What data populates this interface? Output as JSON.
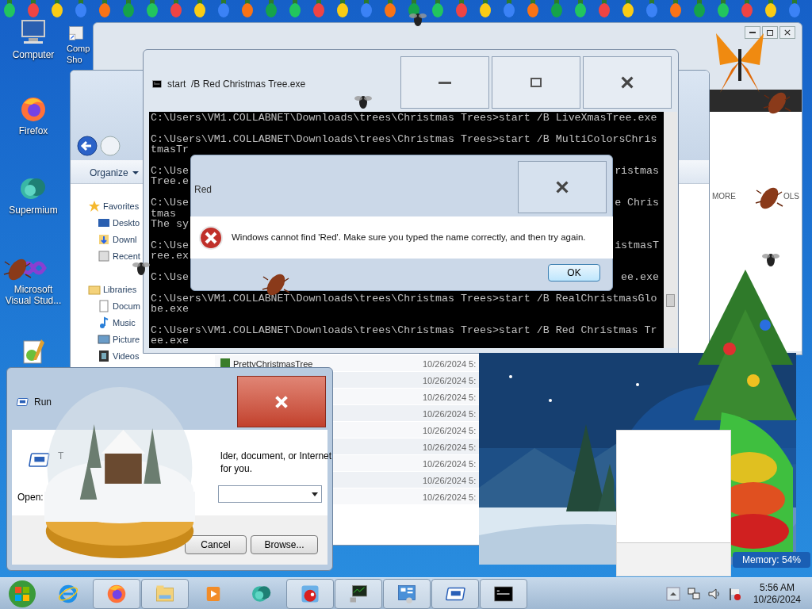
{
  "desktop_icons": [
    {
      "kind": "computer",
      "label": "Computer"
    },
    {
      "kind": "shortcut",
      "label": "Comp Sho"
    },
    {
      "kind": "firefox",
      "label": "Firefox"
    },
    {
      "kind": "supermium",
      "label": "Supermium"
    },
    {
      "kind": "vs",
      "label": "Microsoft Visual Stud..."
    },
    {
      "kind": "notepad"
    }
  ],
  "browser": {
    "items": [
      "MORE",
      "OLS"
    ]
  },
  "explorer": {
    "organize": "Organize",
    "nav": [
      {
        "kind": "favorites",
        "label": "Favorites"
      },
      {
        "kind": "desktop",
        "label": "Deskto"
      },
      {
        "kind": "downloads",
        "label": "Downl"
      },
      {
        "kind": "recent",
        "label": "Recent"
      },
      {
        "kind": "libraries",
        "label": "Libraries"
      },
      {
        "kind": "documents",
        "label": "Docum"
      },
      {
        "kind": "music",
        "label": "Music"
      },
      {
        "kind": "pictures",
        "label": "Picture"
      },
      {
        "kind": "videos",
        "label": "Videos"
      }
    ],
    "files": [
      {
        "name": "PrettyChristmasTree",
        "date": "10/26/2024 5:"
      },
      {
        "date": "10/26/2024 5:"
      },
      {
        "date": "10/26/2024 5:"
      },
      {
        "date": "10/26/2024 5:"
      },
      {
        "date": "10/26/2024 5:"
      },
      {
        "date": "10/26/2024 5:"
      },
      {
        "date": "10/26/2024 5:"
      },
      {
        "date": "10/26/2024 5:"
      },
      {
        "date": "10/26/2024 5:"
      }
    ]
  },
  "cmd": {
    "title": "start  /B Red Christmas Tree.exe",
    "lines": [
      {
        "kind": "text",
        "left": "C:\\Users\\VM1.COLLABNET\\Downloads\\trees\\Christmas Trees>start /B LiveXmasTree.exe"
      },
      {
        "kind": "blank"
      },
      {
        "kind": "text",
        "left": "C:\\Users\\VM1.COLLABNET\\Downloads\\trees\\Christmas Trees>start /B MultiColorsChris"
      },
      {
        "kind": "text",
        "left": "tmasTr"
      },
      {
        "kind": "blank"
      },
      {
        "kind": "text",
        "left": "C:\\Use",
        "right": "ristmas"
      },
      {
        "kind": "text",
        "left": "Tree.e"
      },
      {
        "kind": "blank"
      },
      {
        "kind": "text",
        "left": "C:\\Use",
        "right": "e Chris"
      },
      {
        "kind": "text",
        "left": "tmas"
      },
      {
        "kind": "text",
        "left": "The sy"
      },
      {
        "kind": "blank"
      },
      {
        "kind": "text",
        "left": "C:\\Use",
        "right": "istmasT"
      },
      {
        "kind": "text",
        "left": "ree.ex"
      },
      {
        "kind": "blank"
      },
      {
        "kind": "text",
        "left": "C:\\Use",
        "right": "ee.exe"
      },
      {
        "kind": "blank"
      },
      {
        "kind": "text",
        "left": "C:\\Users\\VM1.COLLABNET\\Downloads\\trees\\Christmas Trees>start /B RealChristmasGlo"
      },
      {
        "kind": "text",
        "left": "be.exe"
      },
      {
        "kind": "blank"
      },
      {
        "kind": "text",
        "left": "C:\\Users\\VM1.COLLABNET\\Downloads\\trees\\Christmas Trees>start /B Red Christmas Tr"
      },
      {
        "kind": "text",
        "left": "ee.exe"
      }
    ]
  },
  "error_dialog": {
    "title": "Red",
    "message": "Windows cannot find 'Red'. Make sure you typed the name correctly, and then try again.",
    "button": "OK"
  },
  "run_dialog": {
    "title": "Run",
    "text_start": "T",
    "text_line_1": "lder, document, or Internet",
    "text_line_2": "for you.",
    "open_label": "Open:",
    "buttons": [
      "Cancel",
      "Browse..."
    ]
  },
  "gadget": {
    "memory": "Memory: 54%"
  },
  "taskbar": {
    "items": [
      {
        "kind": "ie"
      },
      {
        "kind": "firefox"
      },
      {
        "kind": "explorer"
      },
      {
        "kind": "media"
      },
      {
        "kind": "supermium"
      },
      {
        "kind": "game"
      },
      {
        "kind": "monitor"
      },
      {
        "kind": "control"
      },
      {
        "kind": "run"
      },
      {
        "kind": "cmd"
      }
    ],
    "clock": {
      "time": "5:56 AM",
      "date": "10/26/2024"
    }
  }
}
